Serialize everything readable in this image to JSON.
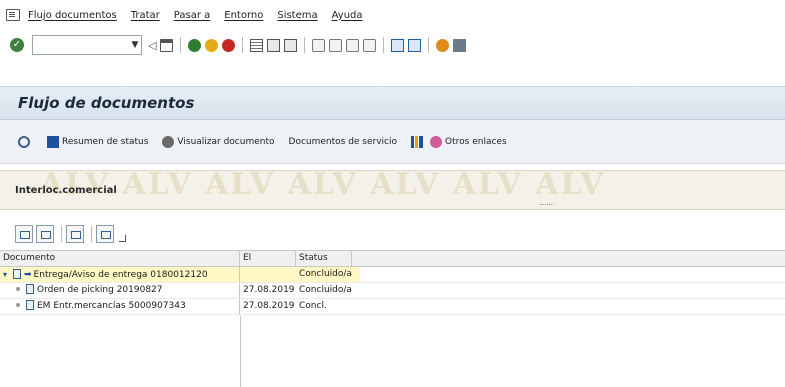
{
  "menu": [
    "Flujo documentos",
    "Tratar",
    "Pasar a",
    "Entorno",
    "Sistema",
    "Ayuda"
  ],
  "toolbar": {
    "command_field_value": "",
    "icons": [
      "enter-icon",
      "back-icon",
      "save-icon",
      "back-green-icon",
      "exit-icon",
      "cancel-icon",
      "print-icon",
      "find-icon",
      "find-next-icon",
      "first-page-icon",
      "prev-page-icon",
      "next-page-icon",
      "last-page-icon",
      "new-session-icon",
      "shortcut-icon",
      "help-icon",
      "layout-icon"
    ]
  },
  "title": "Flujo de documentos",
  "app_toolbar": {
    "status_overview": "Resumen de status",
    "display_document": "Visualizar documento",
    "service_documents": "Documentos de servicio",
    "other_links": "Otros enlaces"
  },
  "partner": {
    "label": "Interloc.comercial",
    "watermark": "ALV ALV ALV ALV ALV ALV ALV"
  },
  "tree": {
    "columns": [
      "Documento",
      "El",
      "Status"
    ],
    "rows": [
      {
        "document": "Entrega/Aviso de entrega 0180012120",
        "date": "",
        "status": "Concluido/a"
      },
      {
        "document": "Orden de picking 20190827",
        "date": "27.08.2019",
        "status": "Concluido/a"
      },
      {
        "document": "EM Entr.mercancías 5000907343",
        "date": "27.08.2019",
        "status": "Concl."
      }
    ]
  }
}
